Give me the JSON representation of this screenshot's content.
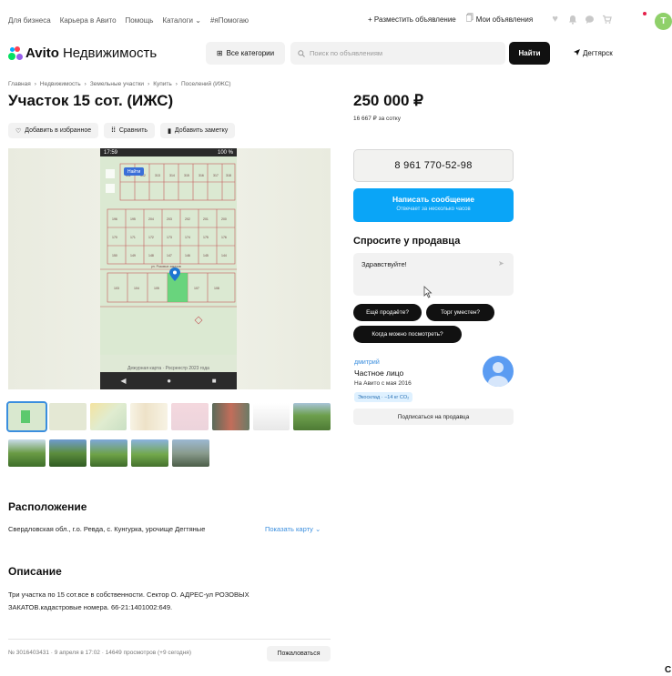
{
  "topbar": {
    "links": [
      "Для бизнеса",
      "Карьера в Авито",
      "Помощь",
      "Каталоги ⌄",
      "#яПомогаю"
    ],
    "post_ad": "+ Разместить объявление",
    "my_ads": "Мои объявления",
    "user_initial": "T"
  },
  "header": {
    "brand": "Avito",
    "section": "Недвижимость",
    "categories": "Все категории",
    "search_placeholder": "Поиск по объявлениям",
    "find": "Найти",
    "location": "Дегтярск"
  },
  "breadcrumbs": [
    "Главная",
    "›",
    "Недвижимость",
    "›",
    "Земельные участки",
    "›",
    "Купить",
    "›",
    "Поселений (ИЖС)"
  ],
  "listing": {
    "title": "Участок 15 сот. (ИЖС)",
    "price": "250 000 ₽",
    "price_per": "16 667 ₽ за сотку",
    "actions": {
      "favorite": "Добавить в избранное",
      "compare": "Сравнить",
      "note": "Добавить заметку"
    }
  },
  "gallery": {
    "status_time": "17:59",
    "status_right": "100 %",
    "map_button": "Найти",
    "map_caption": "Дежурная карта · Росреестр 2023 года",
    "plots_top": [
      "311",
      "312",
      "313",
      "314",
      "315",
      "316",
      "317",
      "318"
    ],
    "plots_mid1": [
      "196",
      "195",
      "204",
      "203",
      "202",
      "201",
      "200"
    ],
    "plots_mid2": [
      "170",
      "171",
      "172",
      "173",
      "174",
      "175",
      "176"
    ],
    "plots_mid3": [
      "150",
      "149",
      "148",
      "147",
      "146",
      "145",
      "144"
    ],
    "plots_bot": [
      "103",
      "104",
      "105",
      "106",
      "107",
      "108"
    ],
    "street": "ул. Розовых закатов"
  },
  "contact": {
    "phone": "8 961 770-52-98",
    "write": "Написать сообщение",
    "reply_time": "Отвечает за несколько часов"
  },
  "ask": {
    "title": "Спросите у продавца",
    "message": "Здравствуйте!",
    "chips": [
      "Ещё продаёте?",
      "Торг уместен?",
      "Когда можно посмотреть?"
    ]
  },
  "seller": {
    "name": "дмитрий",
    "type": "Частное лицо",
    "since": "На Авито с мая 2016",
    "eco": "Экосклад · −14 кг CO₂",
    "subscribe": "Подписаться на продавца"
  },
  "location_section": {
    "heading": "Расположение",
    "address": "Свердловская обл., г.о. Ревда, с. Кунгурка, урочище Дегтяные",
    "show_map": "Показать карту ⌄"
  },
  "description_section": {
    "heading": "Описание",
    "text": "Три участка по 15 сот.все в собственности. Сектор О. АДРЕС-ул РОЗОВЫХ ЗАКАТОВ.кадастровые номера. 66-21:1401002:649."
  },
  "footer": {
    "meta": "№ 3016403431 · 9 апреля в 17:02 · 14649 просмотров (+9 сегодня)",
    "report": "Пожаловаться",
    "corner": "C"
  },
  "colors": {
    "accent_blue": "#0aa5f7",
    "link_blue": "#3a8ede",
    "avatar_green": "#8fd06a"
  }
}
